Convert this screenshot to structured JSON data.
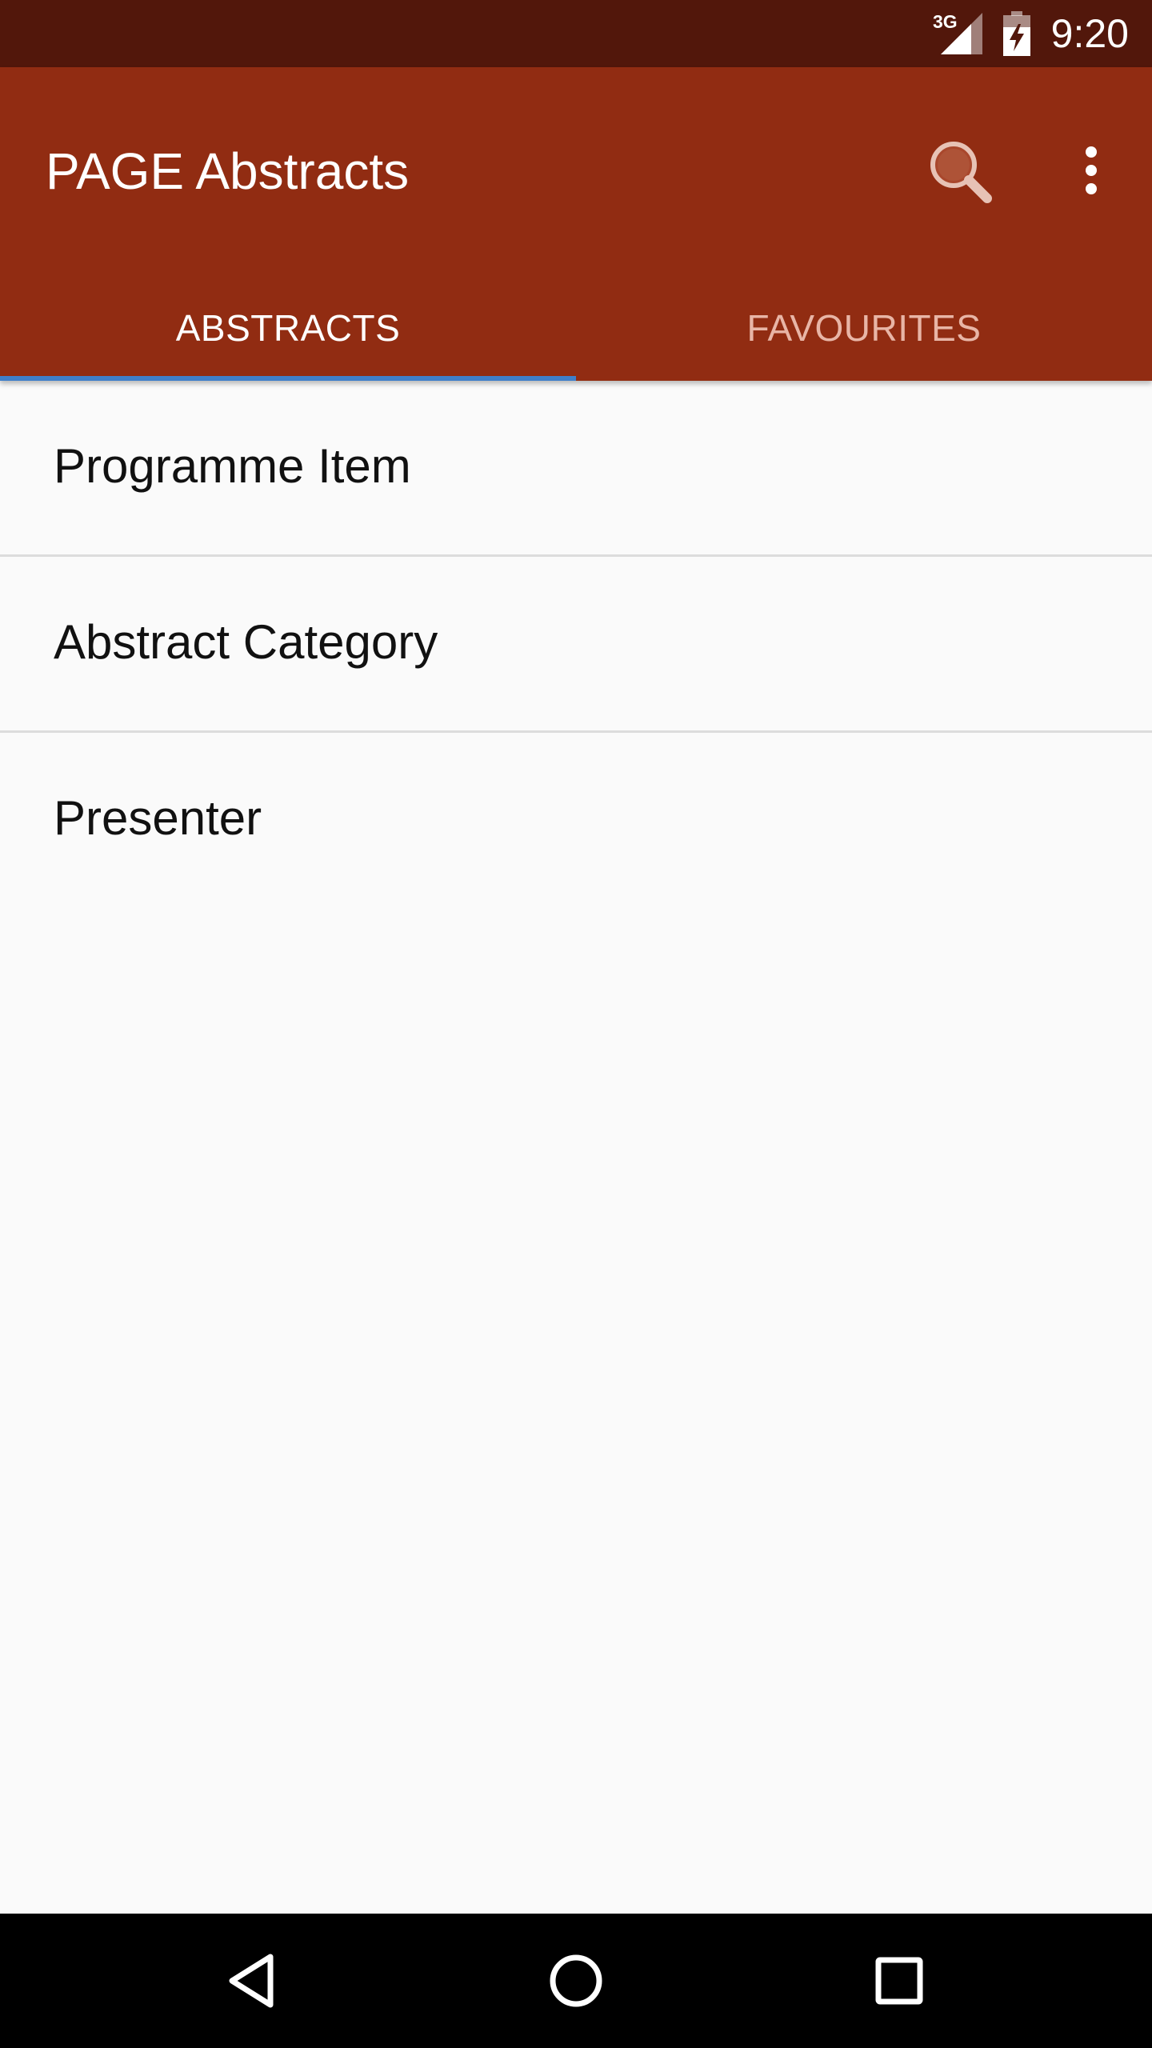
{
  "status_bar": {
    "network": "3G",
    "time": "9:20",
    "icons": [
      "signal-icon",
      "battery-charging-icon"
    ]
  },
  "app_bar": {
    "title": "PAGE Abstracts",
    "actions": [
      "search-icon",
      "overflow-menu-icon"
    ],
    "color": "#912c12"
  },
  "tabs": [
    {
      "label": "ABSTRACTS",
      "selected": true
    },
    {
      "label": "FAVOURITES",
      "selected": false
    }
  ],
  "list": {
    "items": [
      {
        "label": "Programme Item"
      },
      {
        "label": "Abstract Category"
      },
      {
        "label": "Presenter"
      }
    ]
  },
  "nav_bar": {
    "buttons": [
      "back-icon",
      "home-icon",
      "recents-icon"
    ]
  },
  "colors": {
    "status_bar": "#52170b",
    "app_bar": "#912c12",
    "tab_indicator": "#3f7fc9",
    "background": "#fafafa"
  }
}
